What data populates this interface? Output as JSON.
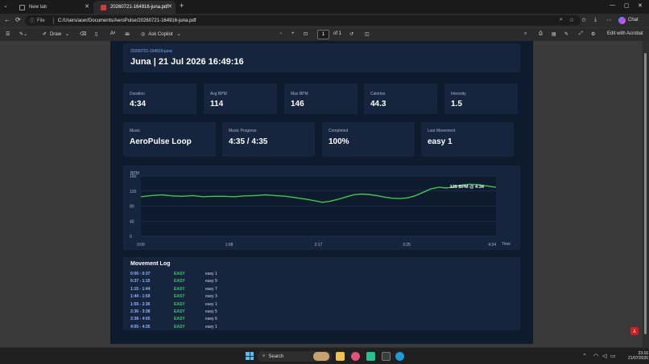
{
  "browser": {
    "tabs": [
      {
        "title": "New tab",
        "active": false
      },
      {
        "title": "20260721-164916-juna.pdf",
        "active": true
      }
    ],
    "address": {
      "scheme_label": "File",
      "url": "C:/Users/acer/Documents/AeroPulse/20260721-164916-juna.pdf"
    },
    "chat_label": "Chat"
  },
  "pdf_toolbar": {
    "draw_label": "Draw",
    "ask_copilot_label": "Ask Copilot",
    "page_current": "1",
    "page_total": "of 1",
    "edit_acrobat_label": "Edit with Acrobat"
  },
  "report": {
    "file_id": "20260721-164916-juna",
    "title": "Juna | 21 Jul 2026 16:49:16",
    "stats_row1": [
      {
        "label": "Duration",
        "value": "4:34"
      },
      {
        "label": "Avg BPM",
        "value": "114"
      },
      {
        "label": "Max BPM",
        "value": "146"
      },
      {
        "label": "Calories",
        "value": "44.3"
      },
      {
        "label": "Intensity",
        "value": "1.5"
      }
    ],
    "stats_row2": [
      {
        "label": "Music",
        "value": "AeroPulse Loop"
      },
      {
        "label": "Music Progress",
        "value": "4:35 / 4:35"
      },
      {
        "label": "Completed",
        "value": "100%"
      },
      {
        "label": "Last Movement",
        "value": "easy 1"
      }
    ],
    "movement_log_title": "Movement Log",
    "movement_log": [
      {
        "time": "0:00 - 0:37",
        "level": "EASY",
        "move": "easy 1"
      },
      {
        "time": "0:37 - 1:15",
        "level": "EASY",
        "move": "easy 9"
      },
      {
        "time": "1:15 - 1:44",
        "level": "EASY",
        "move": "easy 7"
      },
      {
        "time": "1:44 - 1:59",
        "level": "EASY",
        "move": "easy 3"
      },
      {
        "time": "1:59 - 2:36",
        "level": "EASY",
        "move": "easy 1"
      },
      {
        "time": "2:36 - 3:38",
        "level": "EASY",
        "move": "easy 5"
      },
      {
        "time": "3:38 - 4:05",
        "level": "EASY",
        "move": "easy 6"
      },
      {
        "time": "4:05 - 4:35",
        "level": "EASY",
        "move": "easy 1"
      }
    ]
  },
  "chart_data": {
    "type": "line",
    "ylabel": "BPM",
    "xlabel": "Time",
    "annotation": "135 BPM @ 4:34",
    "ylim": [
      160,
      0
    ],
    "y_ticks": [
      "0",
      "40",
      "80",
      "120",
      "160"
    ],
    "x_ticks": [
      "0:00",
      "1:08",
      "2:17",
      "3:25",
      "4:34"
    ],
    "x_tick_seconds": [
      0,
      68,
      137,
      205,
      274
    ],
    "xlim": [
      0,
      274
    ],
    "grid": true,
    "series": [
      {
        "color": "#3cc94e",
        "points": [
          [
            0,
            105
          ],
          [
            8,
            108
          ],
          [
            16,
            110
          ],
          [
            24,
            107
          ],
          [
            32,
            106
          ],
          [
            40,
            108
          ],
          [
            48,
            105
          ],
          [
            56,
            106
          ],
          [
            64,
            106
          ],
          [
            72,
            105
          ],
          [
            80,
            107
          ],
          [
            88,
            108
          ],
          [
            96,
            110
          ],
          [
            104,
            108
          ],
          [
            112,
            106
          ],
          [
            120,
            102
          ],
          [
            128,
            98
          ],
          [
            136,
            93
          ],
          [
            140,
            90
          ],
          [
            146,
            93
          ],
          [
            152,
            98
          ],
          [
            158,
            104
          ],
          [
            164,
            110
          ],
          [
            170,
            112
          ],
          [
            176,
            111
          ],
          [
            182,
            108
          ],
          [
            188,
            104
          ],
          [
            194,
            101
          ],
          [
            200,
            100
          ],
          [
            206,
            102
          ],
          [
            212,
            108
          ],
          [
            218,
            117
          ],
          [
            224,
            126
          ],
          [
            230,
            130
          ],
          [
            236,
            128
          ],
          [
            242,
            132
          ],
          [
            248,
            136
          ],
          [
            254,
            138
          ],
          [
            260,
            137
          ],
          [
            266,
            134
          ],
          [
            274,
            130
          ]
        ]
      }
    ]
  },
  "taskbar": {
    "search_label": "Search",
    "time": "23:16",
    "date": "21/07/2026"
  }
}
